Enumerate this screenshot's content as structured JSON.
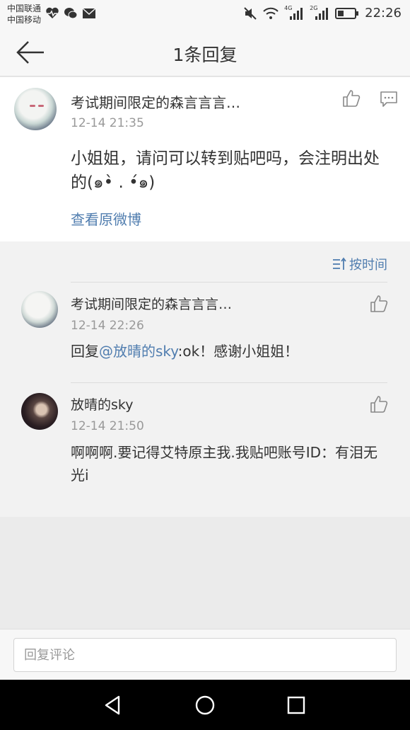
{
  "status_bar": {
    "carrier_1": "中国联通",
    "carrier_2": "中国移动",
    "net_4g": "4G",
    "net_2g": "2G",
    "time": "22:26",
    "icons": [
      "heartbeat-icon",
      "wechat-icon",
      "mail-icon",
      "mute-icon",
      "wifi-icon",
      "signal-icon",
      "battery-icon"
    ]
  },
  "header": {
    "title": "1条回复",
    "back_icon": "back-arrow-icon"
  },
  "main_post": {
    "author": "考试期间限定的森言言言…",
    "time": "12-14 21:35",
    "text": "小姐姐，请问可以转到贴吧吗，会注明出处的(๑•̀ . •́๑)",
    "link": "查看原微博"
  },
  "sort_label": "按时间",
  "replies": [
    {
      "author": "考试期间限定的森言言言…",
      "time": "12-14 22:26",
      "prefix": "回复",
      "mention": "@放晴的sky",
      "text": ":ok！感谢小姐姐！"
    },
    {
      "author": "放晴的sky",
      "time": "12-14 21:50",
      "text": "啊啊啊.要记得艾特原主我.我贴吧账号ID：有泪无光i"
    }
  ],
  "reply_input": {
    "placeholder": "回复评论"
  },
  "colors": {
    "link": "#507daf",
    "meta": "#999999",
    "text": "#333333"
  }
}
